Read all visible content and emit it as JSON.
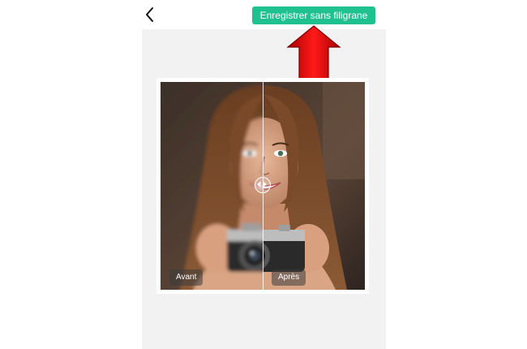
{
  "header": {
    "back_icon": "chevron-left-icon",
    "save_label": "Enregistrer sans filigrane",
    "accent_color": "#1fc28f"
  },
  "comparison": {
    "before_label": "Avant",
    "after_label": "Après",
    "divider_position": 0.5,
    "handle_icon": "left-right-arrows-icon"
  },
  "annotation": {
    "arrow_icon": "up-arrow-icon",
    "arrow_color": "#cc0000"
  }
}
